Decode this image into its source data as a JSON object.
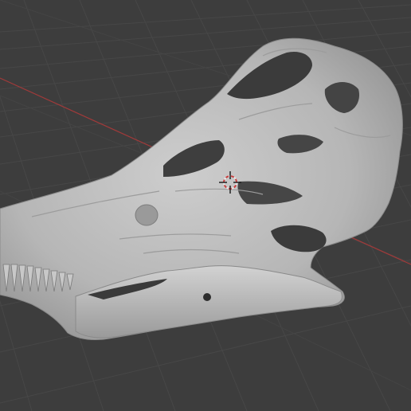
{
  "viewport": {
    "mode": "3D viewport",
    "background_color": "#3d3d3d",
    "grid_color": "#474747",
    "x_axis_color": "#a03a3a"
  },
  "scene": {
    "object": "fossil-skull-mesh",
    "mesh_color": "#b9b9b9",
    "cursor": "3d-cursor-icon"
  }
}
